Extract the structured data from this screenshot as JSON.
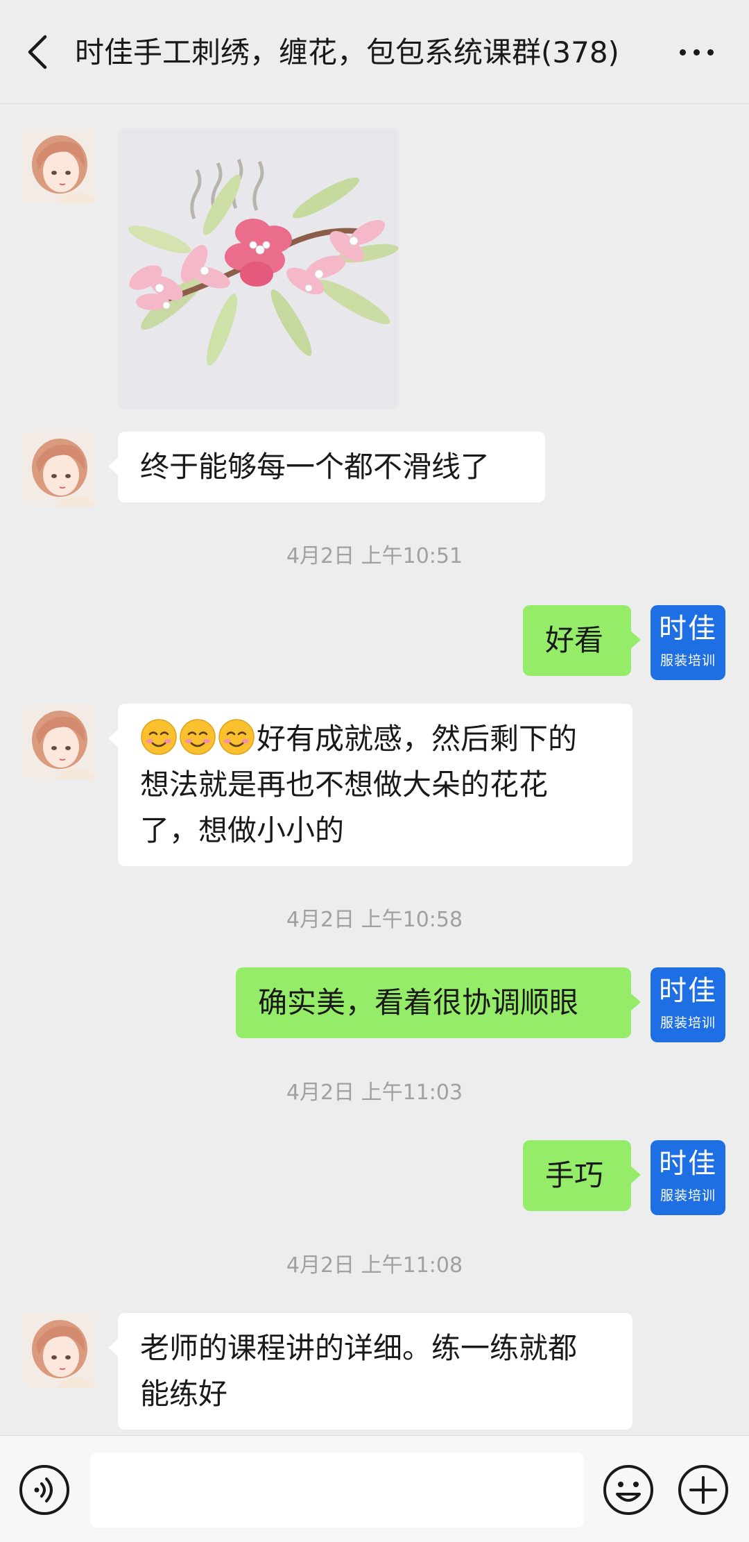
{
  "header": {
    "title": "时佳手工刺绣，缠花，包包系统课群(378)",
    "back_icon": "chevron-left-icon",
    "more_icon": "more-dots-icon"
  },
  "brand_avatar": {
    "line1": "时佳",
    "line2": "服装培训",
    "color": "#1e6fe3"
  },
  "messages": [
    {
      "side": "left",
      "type": "image",
      "image_desc": "pink flower hair comb"
    },
    {
      "side": "left",
      "type": "text",
      "text": "终于能够每一个都不滑线了"
    },
    {
      "type": "timestamp",
      "text": "4月2日 上午10:51"
    },
    {
      "side": "right",
      "type": "text",
      "text": "好看"
    },
    {
      "side": "left",
      "type": "text",
      "line1": "好有成就感，然后剩下的",
      "line2": "想法就是再也不想做大朵的花花",
      "line3": "了，想做小小的",
      "emoji_count": 3
    },
    {
      "type": "timestamp",
      "text": "4月2日 上午10:58"
    },
    {
      "side": "right",
      "type": "text",
      "text": "确实美，看着很协调顺眼"
    },
    {
      "type": "timestamp",
      "text": "4月2日 上午11:03"
    },
    {
      "side": "right",
      "type": "text",
      "text": "手巧"
    },
    {
      "type": "timestamp",
      "text": "4月2日 上午11:08"
    },
    {
      "side": "left",
      "type": "text",
      "line1": "老师的课程讲的详细。练一练就都",
      "line2": "能练好"
    }
  ],
  "input_bar": {
    "voice_icon": "voice-icon",
    "emoji_icon": "smiley-icon",
    "plus_icon": "plus-icon",
    "value": ""
  },
  "colors": {
    "background": "#ededed",
    "my_bubble": "#95ec69",
    "their_bubble": "#ffffff",
    "timestamp": "#a0a0a0"
  }
}
